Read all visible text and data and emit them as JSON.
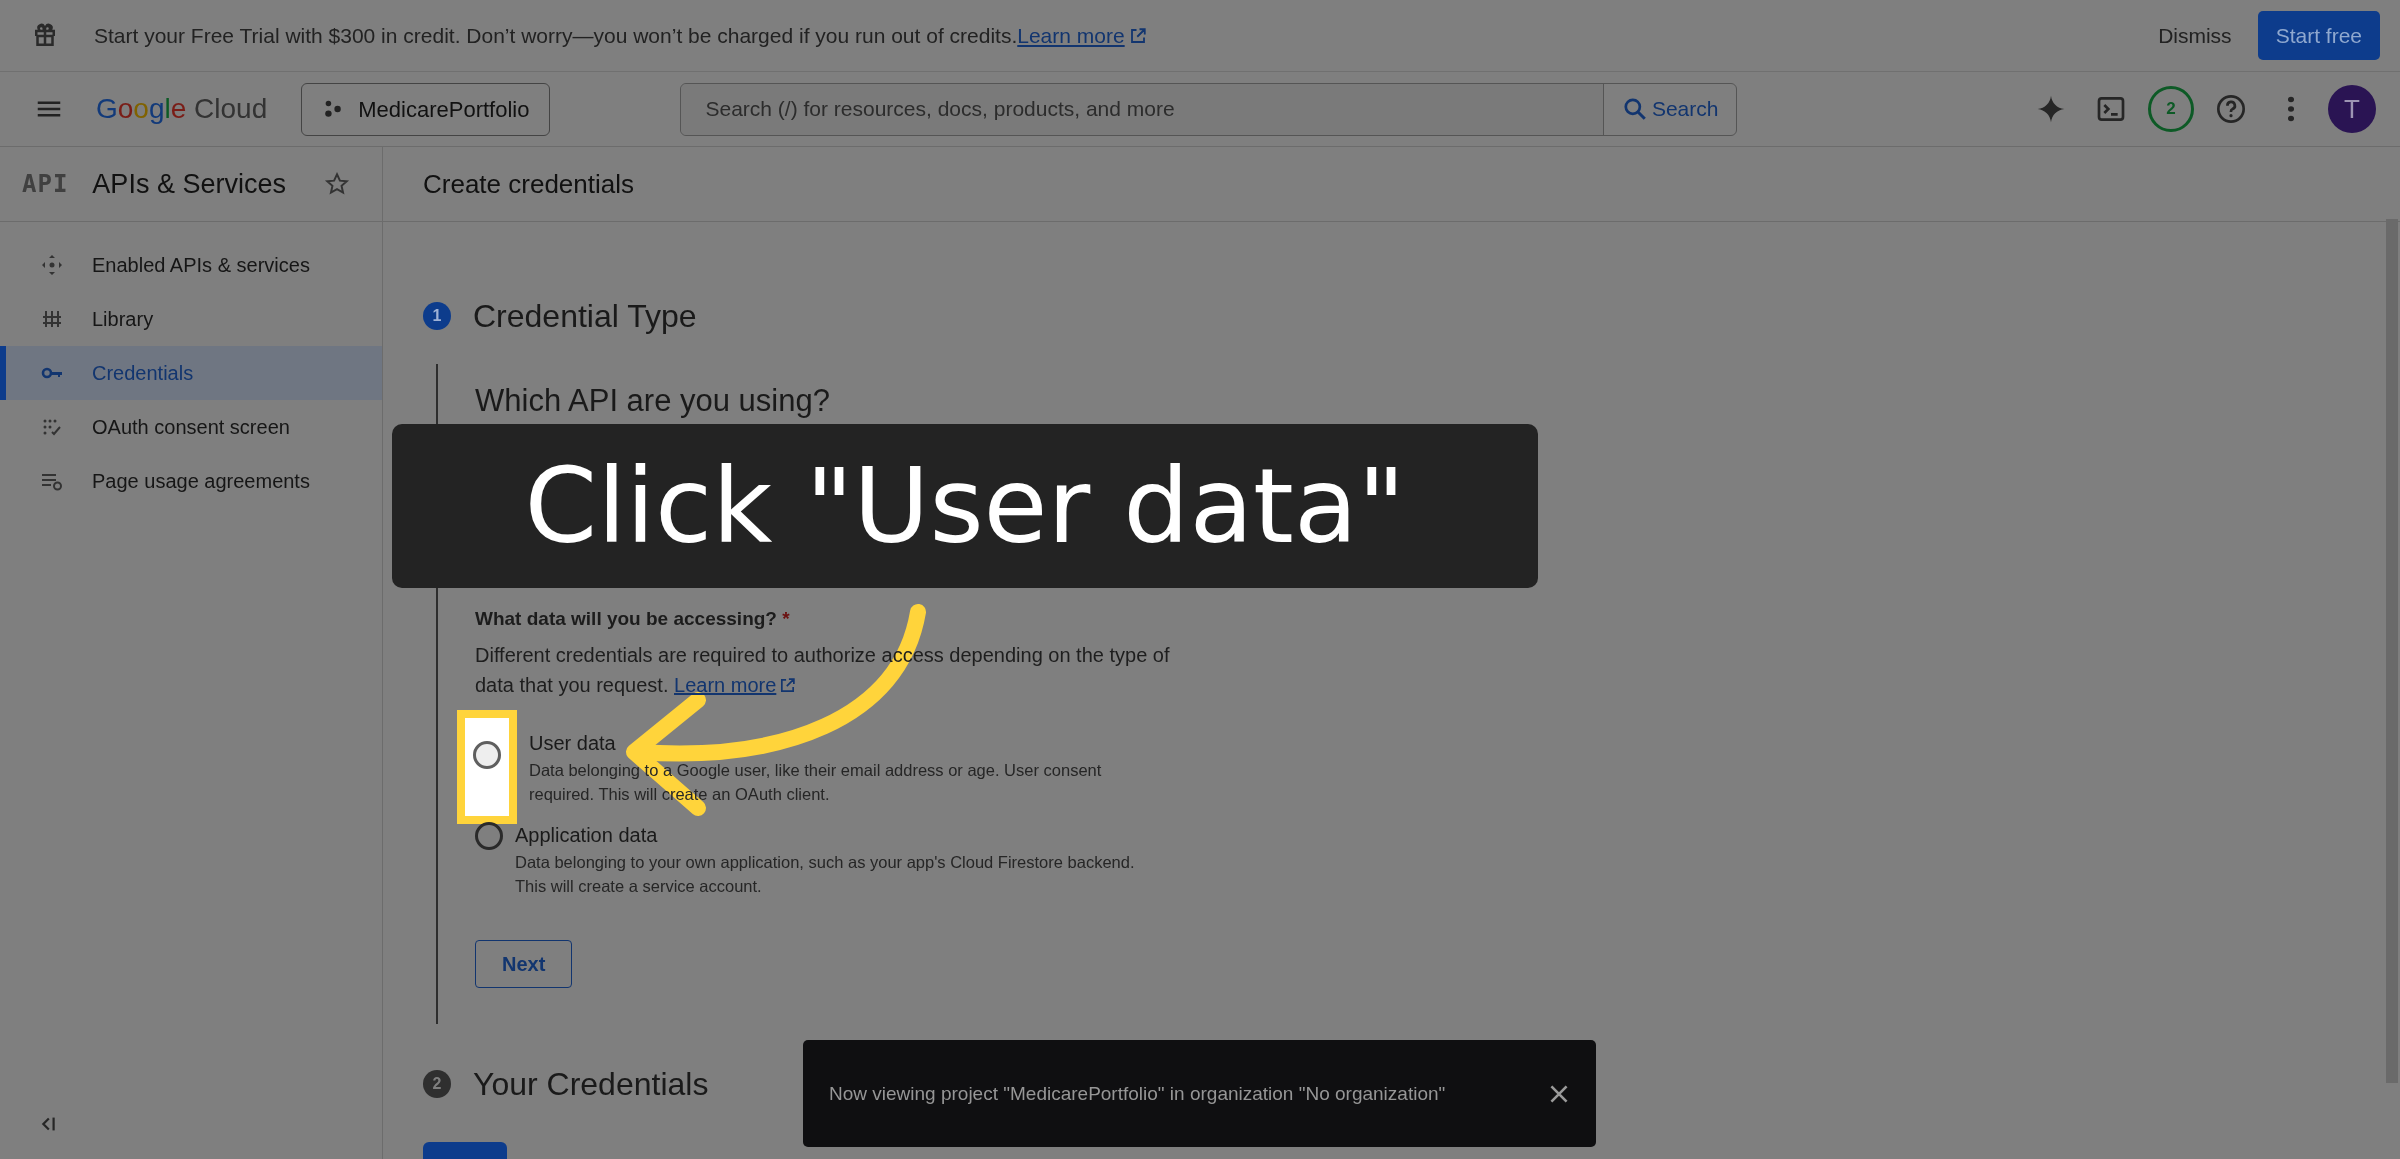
{
  "banner": {
    "text": "Start your Free Trial with $300 in credit. Don’t worry—you won’t be charged if you run out of credits.",
    "link": "Learn more",
    "dismiss": "Dismiss",
    "start": "Start free"
  },
  "header": {
    "logo_word": "Google",
    "logo_product": "Cloud",
    "project": "MedicarePortfolio",
    "search": {
      "placeholder": "Search (/) for resources, docs, products, and more",
      "button": "Search"
    },
    "notifications": "2",
    "avatar": "T"
  },
  "sidebar": {
    "badge": "API",
    "title": "APIs & Services",
    "items": [
      {
        "kind": "enabled",
        "label": "Enabled APIs & services",
        "selected": false
      },
      {
        "kind": "library",
        "label": "Library",
        "selected": false
      },
      {
        "kind": "credentials",
        "label": "Credentials",
        "selected": true
      },
      {
        "kind": "oauth",
        "label": "OAuth consent screen",
        "selected": false
      },
      {
        "kind": "agreements",
        "label": "Page usage agreements",
        "selected": false
      }
    ]
  },
  "page_title": "Create credentials",
  "steps": [
    {
      "number": "1",
      "title": "Credential Type",
      "active": true
    },
    {
      "number": "2",
      "title": "Your Credentials",
      "active": false
    }
  ],
  "form": {
    "heading": "Which API are you using?",
    "question": "What data will you be accessing?",
    "required_mark": "*",
    "description": "Different credentials are required to authorize access depending on the type of data that you request.",
    "link": "Learn more",
    "options": [
      {
        "label": "User data",
        "description": "Data belonging to a Google user, like their email address or age. User consent required. This will create an OAuth client.",
        "selected": false,
        "highlighted": true
      },
      {
        "label": "Application data",
        "description": "Data belonging to your own application, such as your app's Cloud Firestore backend. This will create a service account.",
        "selected": false,
        "highlighted": false
      }
    ],
    "next": "Next"
  },
  "toast": {
    "text": "Now viewing project \"MedicarePortfolio\" in organization \"No organization\""
  },
  "tutorial": {
    "callout": "Click \"User data\""
  }
}
